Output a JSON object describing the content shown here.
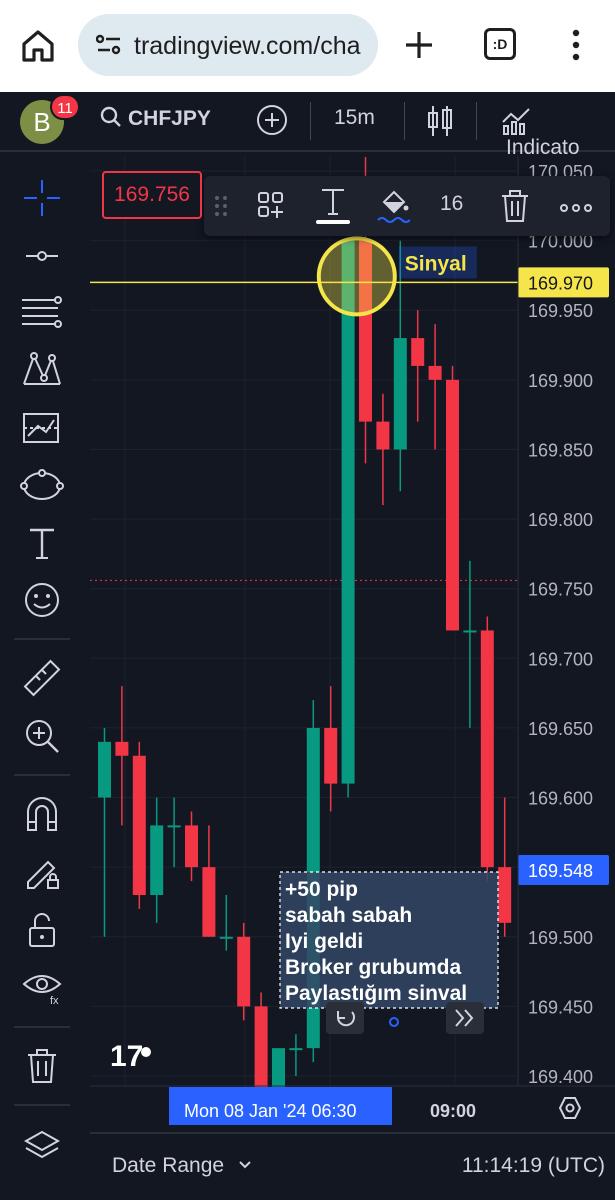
{
  "browser": {
    "url": "tradingview.com/cha",
    "tab_label": ":D"
  },
  "toolbar": {
    "notification_count": "11",
    "avatar_letter": "B",
    "symbol": "CHFJPY",
    "interval": "15m",
    "indicators_label": "Indicato"
  },
  "float_toolbar": {
    "font_size": "16"
  },
  "price_box": {
    "value": "169.756"
  },
  "chart_data": {
    "type": "candlestick",
    "y_axis_ticks": [
      "170.050",
      "170.000",
      "169.950",
      "169.900",
      "169.850",
      "169.800",
      "169.750",
      "169.700",
      "169.650",
      "169.600",
      "169.550",
      "169.500",
      "169.450",
      "169.400"
    ],
    "ylim": [
      169.38,
      170.06
    ],
    "price_labels": [
      {
        "value": "169.970",
        "price": 169.97,
        "color": "#f5e54a"
      },
      {
        "value": "169.548",
        "price": 169.548,
        "color": "#2962ff"
      }
    ],
    "horizontal_line": {
      "price": 169.97,
      "color": "#f5e54a"
    },
    "dotted_line": {
      "price": 169.756,
      "color": "#f23645"
    },
    "signal_label": "Sinyal",
    "annotation_lines": [
      "+50 pip",
      "sabah sabah",
      "Iyi geldi",
      "Broker grubumda",
      "Paylastığım sinval"
    ],
    "x_labels": [
      {
        "text": "Mon 08 Jan '24   06:30",
        "highlight": true
      },
      {
        "text": "09:00",
        "highlight": false
      }
    ],
    "candles": [
      {
        "o": 169.6,
        "h": 169.65,
        "l": 169.5,
        "c": 169.64
      },
      {
        "o": 169.64,
        "h": 169.68,
        "l": 169.58,
        "c": 169.63
      },
      {
        "o": 169.63,
        "h": 169.64,
        "l": 169.52,
        "c": 169.53
      },
      {
        "o": 169.53,
        "h": 169.6,
        "l": 169.51,
        "c": 169.58
      },
      {
        "o": 169.58,
        "h": 169.6,
        "l": 169.55,
        "c": 169.58
      },
      {
        "o": 169.58,
        "h": 169.59,
        "l": 169.54,
        "c": 169.55
      },
      {
        "o": 169.55,
        "h": 169.58,
        "l": 169.5,
        "c": 169.5
      },
      {
        "o": 169.5,
        "h": 169.53,
        "l": 169.49,
        "c": 169.5
      },
      {
        "o": 169.5,
        "h": 169.51,
        "l": 169.44,
        "c": 169.45
      },
      {
        "o": 169.45,
        "h": 169.46,
        "l": 169.38,
        "c": 169.38
      },
      {
        "o": 169.38,
        "h": 169.42,
        "l": 169.37,
        "c": 169.42
      },
      {
        "o": 169.42,
        "h": 169.43,
        "l": 169.4,
        "c": 169.42
      },
      {
        "o": 169.42,
        "h": 169.67,
        "l": 169.41,
        "c": 169.65
      },
      {
        "o": 169.65,
        "h": 169.68,
        "l": 169.59,
        "c": 169.61
      },
      {
        "o": 169.61,
        "h": 170.0,
        "l": 169.6,
        "c": 170.0
      },
      {
        "o": 170.0,
        "h": 170.06,
        "l": 169.84,
        "c": 169.87
      },
      {
        "o": 169.87,
        "h": 169.89,
        "l": 169.81,
        "c": 169.85
      },
      {
        "o": 169.85,
        "h": 170.0,
        "l": 169.82,
        "c": 169.93
      },
      {
        "o": 169.93,
        "h": 169.95,
        "l": 169.87,
        "c": 169.91
      },
      {
        "o": 169.91,
        "h": 169.94,
        "l": 169.85,
        "c": 169.9
      },
      {
        "o": 169.9,
        "h": 169.91,
        "l": 169.72,
        "c": 169.72
      },
      {
        "o": 169.72,
        "h": 169.77,
        "l": 169.65,
        "c": 169.72
      },
      {
        "o": 169.72,
        "h": 169.73,
        "l": 169.54,
        "c": 169.55
      },
      {
        "o": 169.55,
        "h": 169.6,
        "l": 169.5,
        "c": 169.51
      }
    ]
  },
  "bottom": {
    "date_range": "Date Range",
    "clock": "11:14:19 (UTC)"
  },
  "colors": {
    "up": "#089981",
    "down": "#f23645",
    "background": "#131722",
    "accent": "#2962ff"
  }
}
